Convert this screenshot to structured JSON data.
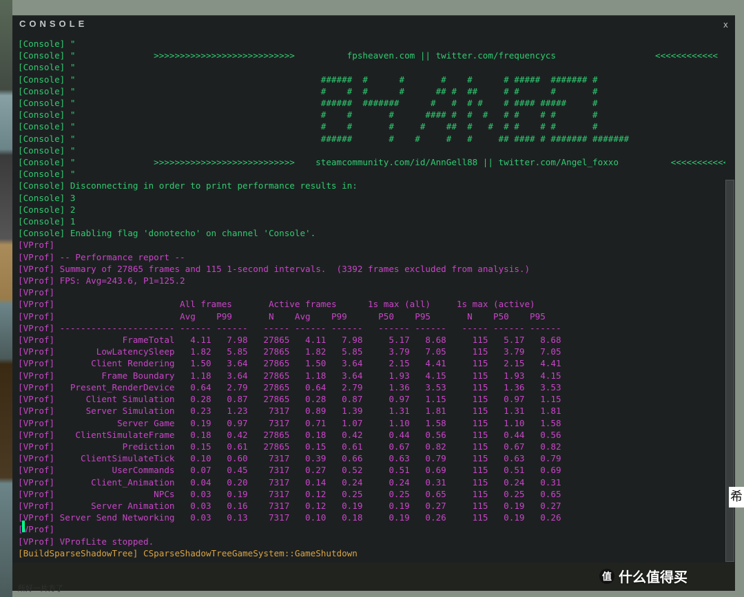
{
  "title": "CONSOLE",
  "close": "x",
  "watermark_text": "什么值得买",
  "watermark_badge": "值",
  "ch_glyph": "希",
  "bottom_tip": "所好一片方了",
  "console_lines": [
    "[Console] \"                                                                                                                                                     \"",
    "[Console] \"               >>>>>>>>>>>>>>>>>>>>>>>>>>>          fpsheaven.com || twitter.com/frequencycs                   <<<<<<<<<<<<",
    "[Console] \"                                                                                                                                                     \"",
    "[Console] \"                                               ######  #      #       #    #      # #####  ####### #                                                \"",
    "[Console] \"                                               #    #  #      #      ## #  ##     # #      #       #                                                \"",
    "[Console] \"                                               ######  #######      #   #  # #    # #### #####     #                                                \"",
    "[Console] \"                                               #    #       #      #### #  #  #   # #    # #       #                                                \"",
    "[Console] \"                                               #    #       #     #    ##  #   #  # #    # #       #                                                \"",
    "[Console] \"                                               ######       #    #     #   #     ## #### # ####### #######                                          \"",
    "[Console] \"                                                                                                                                                     \"",
    "[Console] \"               >>>>>>>>>>>>>>>>>>>>>>>>>>>    steamcommunity.com/id/AnnGell88 || twitter.com/Angel_foxxo          <<<<<<<<<<<<",
    "[Console] \"                                                                                                                                                     \"",
    "[Console] Disconnecting in order to print performance results in:",
    "[Console] 3",
    "[Console] 2",
    "[Console] 1",
    "[Console] Enabling flag 'donotecho' on channel 'Console'."
  ],
  "vprof_header": [
    "[VProf] ",
    "[VProf] -- Performance report --",
    "[VProf] Summary of 27865 frames and 115 1-second intervals.  (3392 frames excluded from analysis.)",
    "[VProf] FPS: Avg=243.6, P1=125.2",
    "[VProf] ",
    "[VProf]                        All frames       Active frames      1s max (all)     1s max (active)",
    "[VProf]                        Avg    P99       N    Avg    P99      P50    P95       N    P50    P95",
    "[VProf] ---------------------- ------ ------   ----- ------ ------   ------ ------   ----- ------ ------"
  ],
  "vprof_rows": [
    {
      "name": "FrameTotal",
      "avg": "4.11",
      "p99": "7.98",
      "n": "27865",
      "aavg": "4.11",
      "ap99": "7.98",
      "p50": "5.17",
      "p95": "8.68",
      "n2": "115",
      "ap50": "5.17",
      "ap95": "8.68"
    },
    {
      "name": "LowLatencySleep",
      "avg": "1.82",
      "p99": "5.85",
      "n": "27865",
      "aavg": "1.82",
      "ap99": "5.85",
      "p50": "3.79",
      "p95": "7.05",
      "n2": "115",
      "ap50": "3.79",
      "ap95": "7.05"
    },
    {
      "name": "Client Rendering",
      "avg": "1.50",
      "p99": "3.64",
      "n": "27865",
      "aavg": "1.50",
      "ap99": "3.64",
      "p50": "2.15",
      "p95": "4.41",
      "n2": "115",
      "ap50": "2.15",
      "ap95": "4.41"
    },
    {
      "name": "Frame Boundary",
      "avg": "1.18",
      "p99": "3.64",
      "n": "27865",
      "aavg": "1.18",
      "ap99": "3.64",
      "p50": "1.93",
      "p95": "4.15",
      "n2": "115",
      "ap50": "1.93",
      "ap95": "4.15"
    },
    {
      "name": "Present_RenderDevice",
      "avg": "0.64",
      "p99": "2.79",
      "n": "27865",
      "aavg": "0.64",
      "ap99": "2.79",
      "p50": "1.36",
      "p95": "3.53",
      "n2": "115",
      "ap50": "1.36",
      "ap95": "3.53"
    },
    {
      "name": "Client Simulation",
      "avg": "0.28",
      "p99": "0.87",
      "n": "27865",
      "aavg": "0.28",
      "ap99": "0.87",
      "p50": "0.97",
      "p95": "1.15",
      "n2": "115",
      "ap50": "0.97",
      "ap95": "1.15"
    },
    {
      "name": "Server Simulation",
      "avg": "0.23",
      "p99": "1.23",
      "n": "7317",
      "aavg": "0.89",
      "ap99": "1.39",
      "p50": "1.31",
      "p95": "1.81",
      "n2": "115",
      "ap50": "1.31",
      "ap95": "1.81"
    },
    {
      "name": "Server Game",
      "avg": "0.19",
      "p99": "0.97",
      "n": "7317",
      "aavg": "0.71",
      "ap99": "1.07",
      "p50": "1.10",
      "p95": "1.58",
      "n2": "115",
      "ap50": "1.10",
      "ap95": "1.58"
    },
    {
      "name": "ClientSimulateFrame",
      "avg": "0.18",
      "p99": "0.42",
      "n": "27865",
      "aavg": "0.18",
      "ap99": "0.42",
      "p50": "0.44",
      "p95": "0.56",
      "n2": "115",
      "ap50": "0.44",
      "ap95": "0.56"
    },
    {
      "name": "Prediction",
      "avg": "0.15",
      "p99": "0.61",
      "n": "27865",
      "aavg": "0.15",
      "ap99": "0.61",
      "p50": "0.67",
      "p95": "0.82",
      "n2": "115",
      "ap50": "0.67",
      "ap95": "0.82"
    },
    {
      "name": "ClientSimulateTick",
      "avg": "0.10",
      "p99": "0.60",
      "n": "7317",
      "aavg": "0.39",
      "ap99": "0.66",
      "p50": "0.63",
      "p95": "0.79",
      "n2": "115",
      "ap50": "0.63",
      "ap95": "0.79"
    },
    {
      "name": "UserCommands",
      "avg": "0.07",
      "p99": "0.45",
      "n": "7317",
      "aavg": "0.27",
      "ap99": "0.52",
      "p50": "0.51",
      "p95": "0.69",
      "n2": "115",
      "ap50": "0.51",
      "ap95": "0.69"
    },
    {
      "name": "Client_Animation",
      "avg": "0.04",
      "p99": "0.20",
      "n": "7317",
      "aavg": "0.14",
      "ap99": "0.24",
      "p50": "0.24",
      "p95": "0.31",
      "n2": "115",
      "ap50": "0.24",
      "ap95": "0.31"
    },
    {
      "name": "NPCs",
      "avg": "0.03",
      "p99": "0.19",
      "n": "7317",
      "aavg": "0.12",
      "ap99": "0.25",
      "p50": "0.25",
      "p95": "0.65",
      "n2": "115",
      "ap50": "0.25",
      "ap95": "0.65"
    },
    {
      "name": "Server Animation",
      "avg": "0.03",
      "p99": "0.16",
      "n": "7317",
      "aavg": "0.12",
      "ap99": "0.19",
      "p50": "0.19",
      "p95": "0.27",
      "n2": "115",
      "ap50": "0.19",
      "ap95": "0.27"
    },
    {
      "name": "Server Send Networking",
      "avg": "0.03",
      "p99": "0.13",
      "n": "7317",
      "aavg": "0.10",
      "ap99": "0.18",
      "p50": "0.19",
      "p95": "0.26",
      "n2": "115",
      "ap50": "0.19",
      "ap95": "0.26"
    }
  ],
  "vprof_footer": [
    "[VProf] ",
    "[VProf] VProfLite stopped."
  ],
  "build_line": {
    "prefix": "[BuildSparseShadowTree] ",
    "text": "CSparseShadowTreeGameSystem::GameShutdown"
  }
}
